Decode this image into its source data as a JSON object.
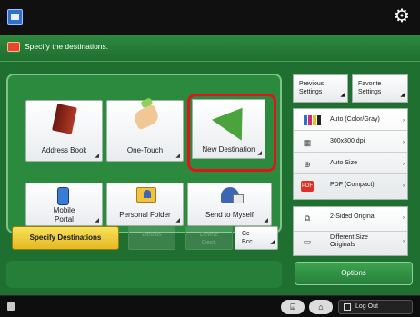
{
  "topbar": {
    "title": "",
    "gear_icon": "gear-icon"
  },
  "header": {
    "message": "Specify the destinations.",
    "time": ""
  },
  "tiles": [
    {
      "key": "address_book",
      "label": "Address Book",
      "icon": "address-book-icon"
    },
    {
      "key": "one_touch",
      "label": "One-Touch",
      "icon": "one-touch-icon"
    },
    {
      "key": "new_destination",
      "label": "New Destination",
      "icon": "paper-plane-icon",
      "highlighted": true
    },
    {
      "key": "mobile_portal",
      "label": "Mobile\nPortal",
      "icon": "mobile-icon"
    },
    {
      "key": "personal_folder",
      "label": "Personal Folder",
      "icon": "folder-icon"
    },
    {
      "key": "send_to_myself",
      "label": "Send to Myself",
      "icon": "send-myself-icon"
    }
  ],
  "actions": {
    "specify_destinations": "Specify Destinations",
    "details": "Details",
    "delete_dest": "Delete\nDest.",
    "cc_bcc": "Cc\nBcc"
  },
  "right_panel": {
    "previous_settings": "Previous\nSettings",
    "favorite_settings": "Favorite\nSettings",
    "settings": [
      {
        "icon": "color-mode-icon",
        "value": "Auto (Color/Gray)"
      },
      {
        "icon": "resolution-icon",
        "value": "300x300 dpi"
      },
      {
        "icon": "size-icon",
        "value": "Auto Size"
      },
      {
        "icon": "pdf-icon",
        "value": "PDF (Compact)"
      }
    ],
    "more_settings": [
      {
        "icon": "two-sided-icon",
        "value": "2-Sided Original"
      },
      {
        "icon": "different-size-icon",
        "value": "Different Size\nOriginals"
      }
    ],
    "options": "Options"
  },
  "bottombar": {
    "logout": "Log Out"
  },
  "colors": {
    "accent_green": "#1f6f31",
    "highlight_red": "#e0151b",
    "specify_yellow": "#f0cf3b"
  }
}
